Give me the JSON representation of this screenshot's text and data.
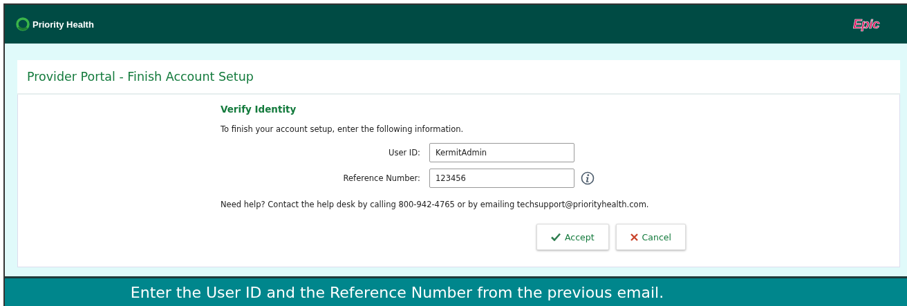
{
  "header": {
    "brand": "Priority Health",
    "vendor_logo": "Epic"
  },
  "panel": {
    "title": "Provider Portal - Finish Account Setup",
    "heading": "Verify Identity",
    "intro": "To finish your account setup, enter the following information.",
    "fields": [
      {
        "label": "User ID:",
        "value": "KermitAdmin",
        "info": false
      },
      {
        "label": "Reference Number:",
        "value": "123456",
        "info": true
      }
    ],
    "help": "Need help? Contact the help desk by calling 800-942-4765 or by emailing techsupport@priorityhealth.com.",
    "buttons": [
      {
        "label": "Accept",
        "kind": "accept"
      },
      {
        "label": "Cancel",
        "kind": "cancel"
      }
    ]
  },
  "caption": "Enter the User ID and the Reference Number from the previous email."
}
